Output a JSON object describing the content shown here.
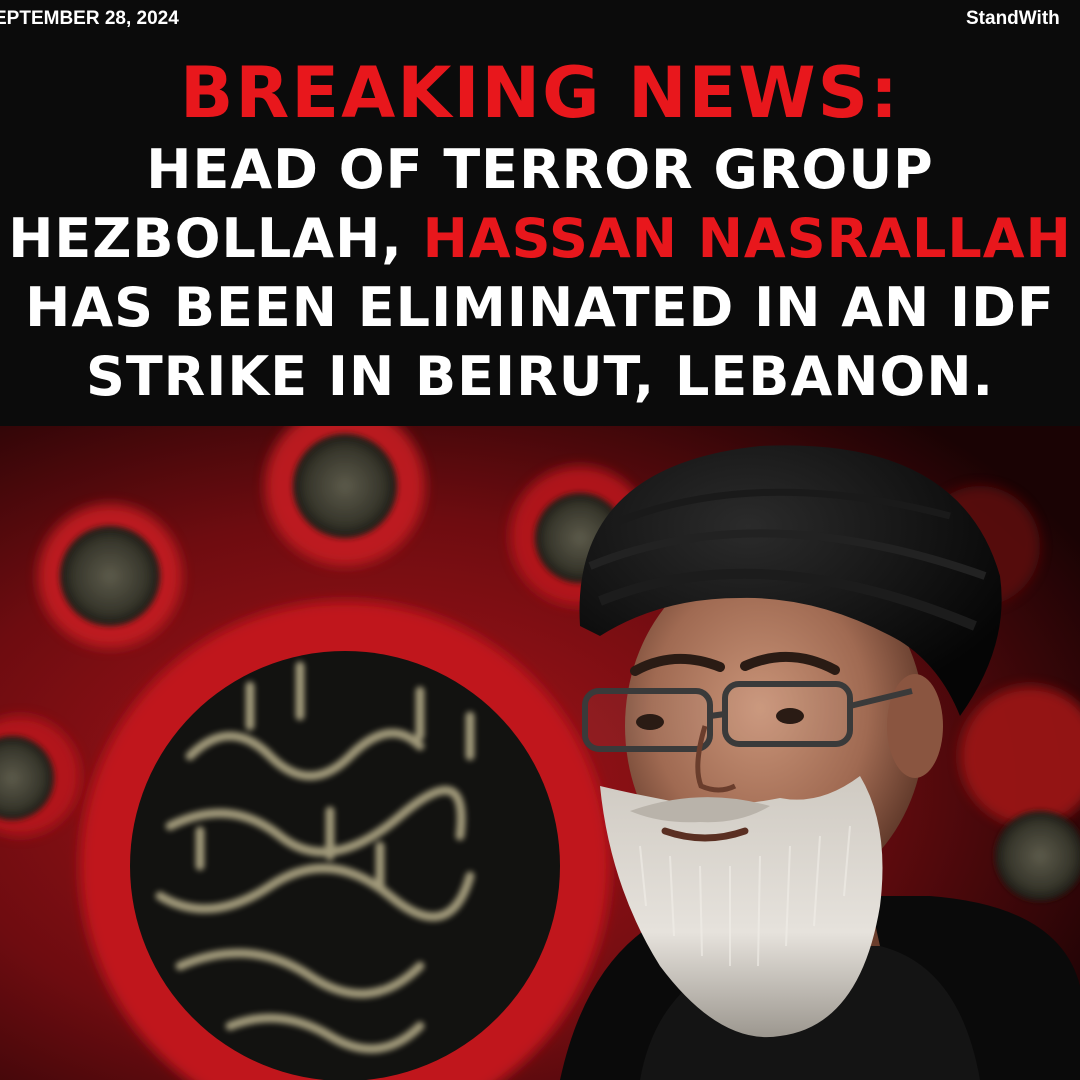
{
  "date": "EPTEMBER 28, 2024",
  "handle": "StandWith",
  "headline": {
    "kicker": "BREAKING NEWS:",
    "line1": "HEAD OF TERROR GROUP",
    "line2_prefix": "HEZBOLLAH, ",
    "line2_name": "HASSAN NASRALLAH",
    "line3": "HAS BEEN ELIMINATED IN AN IDF",
    "line4": "STRIKE IN BEIRUT, LEBANON."
  },
  "colors": {
    "accent_red": "#e8171c",
    "text_white": "#ffffff",
    "header_bg": "#0b0b0b"
  },
  "photo": {
    "description_icon": "portrait-photo"
  }
}
